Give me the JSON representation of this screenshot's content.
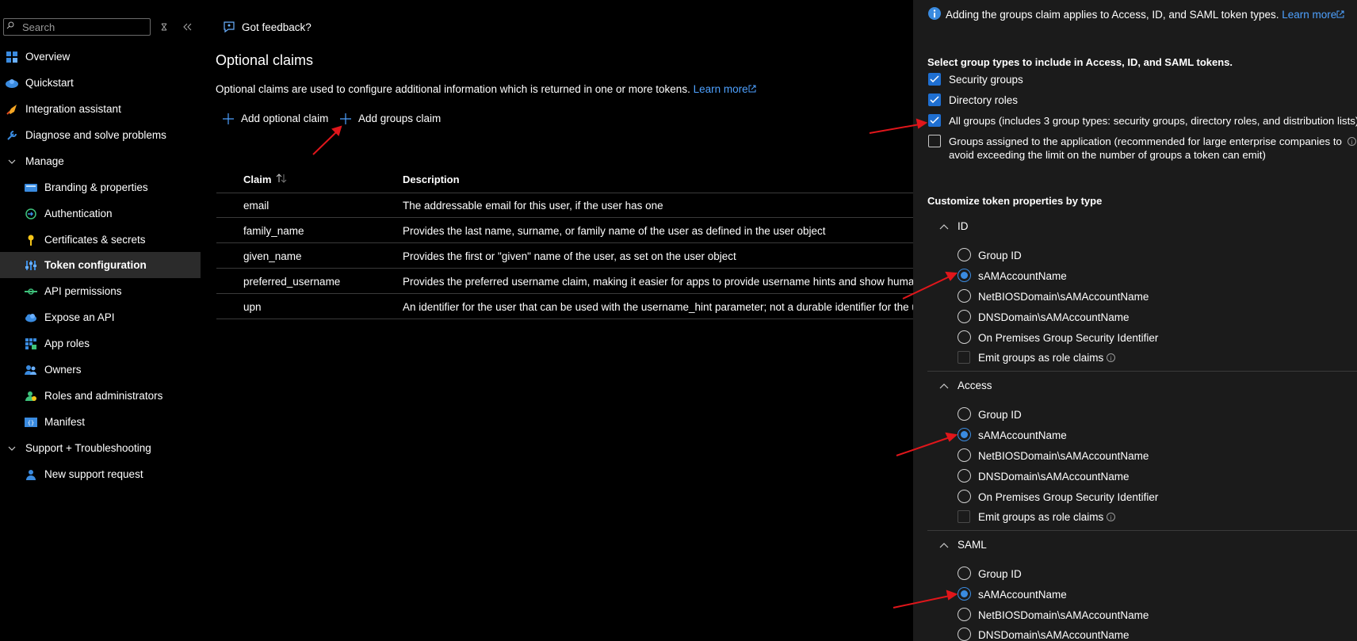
{
  "sidebar": {
    "search_placeholder": "Search",
    "items": [
      {
        "label": "Overview",
        "icon": "overview-icon"
      },
      {
        "label": "Quickstart",
        "icon": "quickstart-icon"
      },
      {
        "label": "Integration assistant",
        "icon": "rocket-icon"
      },
      {
        "label": "Diagnose and solve problems",
        "icon": "wrench-icon"
      },
      {
        "label": "Manage",
        "icon": "chevron-down-icon"
      },
      {
        "label": "Branding & properties",
        "icon": "branding-icon"
      },
      {
        "label": "Authentication",
        "icon": "authentication-icon"
      },
      {
        "label": "Certificates & secrets",
        "icon": "key-icon"
      },
      {
        "label": "Token configuration",
        "icon": "token-icon"
      },
      {
        "label": "API permissions",
        "icon": "api-permissions-icon"
      },
      {
        "label": "Expose an API",
        "icon": "cloud-icon"
      },
      {
        "label": "App roles",
        "icon": "app-roles-icon"
      },
      {
        "label": "Owners",
        "icon": "owners-icon"
      },
      {
        "label": "Roles and administrators",
        "icon": "roles-icon"
      },
      {
        "label": "Manifest",
        "icon": "manifest-icon"
      },
      {
        "label": "Support + Troubleshooting",
        "icon": "chevron-down-icon"
      },
      {
        "label": "New support request",
        "icon": "support-person-icon"
      }
    ]
  },
  "main": {
    "feedback": "Got feedback?",
    "title": "Optional claims",
    "description": "Optional claims are used to configure additional information which is returned in one or more tokens.",
    "learn_more": "Learn more",
    "add_optional_claim": "Add optional claim",
    "add_groups_claim": "Add groups claim",
    "table": {
      "headers": [
        "Claim",
        "Description"
      ],
      "rows": [
        {
          "claim": "email",
          "description": "The addressable email for this user, if the user has one"
        },
        {
          "claim": "family_name",
          "description": "Provides the last name, surname, or family name of the user as defined in the user object"
        },
        {
          "claim": "given_name",
          "description": "Provides the first or \"given\" name of the user, as set on the user object"
        },
        {
          "claim": "preferred_username",
          "description": "Provides the preferred username claim, making it easier for apps to provide username hints and show human rea"
        },
        {
          "claim": "upn",
          "description": "An identifier for the user that can be used with the username_hint parameter; not a durable identifier for the user"
        }
      ]
    }
  },
  "panel": {
    "info_text": "Adding the groups claim applies to Access, ID, and SAML token types.",
    "info_link": "Learn more",
    "group_types_heading": "Select group types to include in Access, ID, and SAML tokens.",
    "group_types": [
      {
        "label": "Security groups",
        "checked": true
      },
      {
        "label": "Directory roles",
        "checked": true
      },
      {
        "label": "All groups (includes 3 group types: security groups, directory roles, and distribution lists)",
        "checked": true
      },
      {
        "label": "Groups assigned to the application (recommended for large enterprise companies to",
        "label2": "avoid exceeding the limit on the number of groups a token can emit)",
        "checked": false
      }
    ],
    "customize_heading": "Customize token properties by type",
    "sections": [
      {
        "title": "ID",
        "options": [
          "Group ID",
          "sAMAccountName",
          "NetBIOSDomain\\sAMAccountName",
          "DNSDomain\\sAMAccountName",
          "On Premises Group Security Identifier"
        ],
        "selected": "sAMAccountName",
        "emit_label": "Emit groups as role claims"
      },
      {
        "title": "Access",
        "options": [
          "Group ID",
          "sAMAccountName",
          "NetBIOSDomain\\sAMAccountName",
          "DNSDomain\\sAMAccountName",
          "On Premises Group Security Identifier"
        ],
        "selected": "sAMAccountName",
        "emit_label": "Emit groups as role claims"
      },
      {
        "title": "SAML",
        "options": [
          "Group ID",
          "sAMAccountName",
          "NetBIOSDomain\\sAMAccountName",
          "DNSDomain\\sAMAccountName"
        ],
        "selected": "sAMAccountName"
      }
    ]
  },
  "colors": {
    "background": "#000000",
    "panel": "#1b1b1b",
    "accent": "#1f6fd1",
    "link": "#4ea1ff",
    "arrow": "#e0161b"
  }
}
